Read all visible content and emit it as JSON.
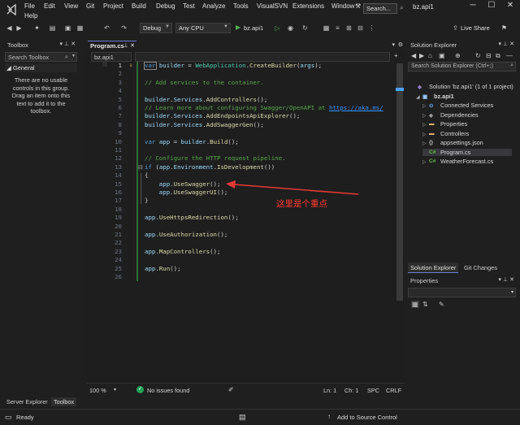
{
  "titlebar": {
    "menu": [
      "File",
      "Edit",
      "View",
      "Git",
      "Project",
      "Build",
      "Debug",
      "Test",
      "Analyze",
      "Tools",
      "VisualSVN",
      "Extensions",
      "Window",
      "Help"
    ],
    "search_label": "Search...",
    "window_title": "bz.api1",
    "minimize": "─",
    "maximize": "☐",
    "close": "✕"
  },
  "toolbar": {
    "config": "Debug",
    "platform": "Any CPU",
    "run_target": "bz.api1",
    "live_share": "Live Share"
  },
  "toolbox": {
    "title": "Toolbox",
    "search_placeholder": "Search Toolbox",
    "group": "General",
    "empty_message": "There are no usable controls in this group. Drag an item onto this text to add it to the toolbox.",
    "tabs": [
      "Server Explorer",
      "Toolbox"
    ]
  },
  "editor": {
    "tab_title": "Program.cs",
    "nav_project": "bz.api1",
    "zoom": "100 %",
    "issues": "No issues found",
    "line_info": "Ln: 1",
    "col_info": "Ch: 1",
    "encoding": "SPC",
    "line_ending": "CRLF",
    "annotation": "这里是个重点",
    "lines": [
      {
        "n": "1",
        "segments": [
          {
            "t": "var",
            "c": "kw"
          },
          {
            "t": " ",
            "c": "pl"
          },
          {
            "t": "builder",
            "c": "id"
          },
          {
            "t": " = ",
            "c": "pl"
          },
          {
            "t": "WebApplication",
            "c": "ty"
          },
          {
            "t": ".",
            "c": "pl"
          },
          {
            "t": "CreateBuilder",
            "c": "mt"
          },
          {
            "t": "(",
            "c": "pl"
          },
          {
            "t": "args",
            "c": "id"
          },
          {
            "t": ");",
            "c": "pl"
          }
        ]
      },
      {
        "n": "2",
        "segments": []
      },
      {
        "n": "3",
        "segments": [
          {
            "t": "// Add services to the container.",
            "c": "cm"
          }
        ]
      },
      {
        "n": "4",
        "segments": []
      },
      {
        "n": "5",
        "segments": [
          {
            "t": "builder",
            "c": "id"
          },
          {
            "t": ".",
            "c": "pl"
          },
          {
            "t": "Services",
            "c": "id"
          },
          {
            "t": ".",
            "c": "pl"
          },
          {
            "t": "AddControllers",
            "c": "mt"
          },
          {
            "t": "();",
            "c": "pl"
          }
        ]
      },
      {
        "n": "6",
        "segments": [
          {
            "t": "// Learn more about configuring Swagger/OpenAPI at ",
            "c": "cm"
          },
          {
            "t": "https://aka.ms/",
            "c": "ln-link"
          }
        ]
      },
      {
        "n": "7",
        "segments": [
          {
            "t": "builder",
            "c": "id"
          },
          {
            "t": ".",
            "c": "pl"
          },
          {
            "t": "Services",
            "c": "id"
          },
          {
            "t": ".",
            "c": "pl"
          },
          {
            "t": "AddEndpointsApiExplorer",
            "c": "mt"
          },
          {
            "t": "();",
            "c": "pl"
          }
        ]
      },
      {
        "n": "8",
        "segments": [
          {
            "t": "builder",
            "c": "id"
          },
          {
            "t": ".",
            "c": "pl"
          },
          {
            "t": "Services",
            "c": "id"
          },
          {
            "t": ".",
            "c": "pl"
          },
          {
            "t": "AddSwaggerGen",
            "c": "mt"
          },
          {
            "t": "();",
            "c": "pl"
          }
        ]
      },
      {
        "n": "9",
        "segments": []
      },
      {
        "n": "10",
        "segments": [
          {
            "t": "var",
            "c": "kw"
          },
          {
            "t": " ",
            "c": "pl"
          },
          {
            "t": "app",
            "c": "id"
          },
          {
            "t": " = ",
            "c": "pl"
          },
          {
            "t": "builder",
            "c": "id"
          },
          {
            "t": ".",
            "c": "pl"
          },
          {
            "t": "Build",
            "c": "mt"
          },
          {
            "t": "();",
            "c": "pl"
          }
        ]
      },
      {
        "n": "11",
        "segments": []
      },
      {
        "n": "12",
        "segments": [
          {
            "t": "// Configure the HTTP request pipeline.",
            "c": "cm"
          }
        ]
      },
      {
        "n": "13",
        "segments": [
          {
            "t": "if",
            "c": "kw"
          },
          {
            "t": " (",
            "c": "pl"
          },
          {
            "t": "app",
            "c": "id"
          },
          {
            "t": ".",
            "c": "pl"
          },
          {
            "t": "Environment",
            "c": "id"
          },
          {
            "t": ".",
            "c": "pl"
          },
          {
            "t": "IsDevelopment",
            "c": "mt"
          },
          {
            "t": "())",
            "c": "pl"
          }
        ]
      },
      {
        "n": "14",
        "segments": [
          {
            "t": "{",
            "c": "pl"
          }
        ]
      },
      {
        "n": "15",
        "segments": [
          {
            "t": "    app",
            "c": "id"
          },
          {
            "t": ".",
            "c": "pl"
          },
          {
            "t": "UseSwagger",
            "c": "mt"
          },
          {
            "t": "();",
            "c": "pl"
          }
        ]
      },
      {
        "n": "16",
        "segments": [
          {
            "t": "    app",
            "c": "id"
          },
          {
            "t": ".",
            "c": "pl"
          },
          {
            "t": "UseSwaggerUI",
            "c": "mt"
          },
          {
            "t": "();",
            "c": "pl"
          }
        ]
      },
      {
        "n": "17",
        "segments": [
          {
            "t": "}",
            "c": "pl"
          }
        ]
      },
      {
        "n": "18",
        "segments": []
      },
      {
        "n": "19",
        "segments": [
          {
            "t": "app",
            "c": "id"
          },
          {
            "t": ".",
            "c": "pl"
          },
          {
            "t": "UseHttpsRedirection",
            "c": "mt"
          },
          {
            "t": "();",
            "c": "pl"
          }
        ]
      },
      {
        "n": "20",
        "segments": []
      },
      {
        "n": "21",
        "segments": [
          {
            "t": "app",
            "c": "id"
          },
          {
            "t": ".",
            "c": "pl"
          },
          {
            "t": "UseAuthorization",
            "c": "mt"
          },
          {
            "t": "();",
            "c": "pl"
          }
        ]
      },
      {
        "n": "22",
        "segments": []
      },
      {
        "n": "23",
        "segments": [
          {
            "t": "app",
            "c": "id"
          },
          {
            "t": ".",
            "c": "pl"
          },
          {
            "t": "MapControllers",
            "c": "mt"
          },
          {
            "t": "();",
            "c": "pl"
          }
        ]
      },
      {
        "n": "24",
        "segments": []
      },
      {
        "n": "25",
        "segments": [
          {
            "t": "app",
            "c": "id"
          },
          {
            "t": ".",
            "c": "pl"
          },
          {
            "t": "Run",
            "c": "mt"
          },
          {
            "t": "();",
            "c": "pl"
          }
        ]
      },
      {
        "n": "26",
        "segments": []
      }
    ]
  },
  "solution_explorer": {
    "title": "Solution Explorer",
    "search_placeholder": "Search Solution Explorer (Ctrl+;)",
    "items": [
      {
        "label": "Solution 'bz.api1' (1 of 1 project)",
        "icon": "solution-icon"
      },
      {
        "label": "bz.api1",
        "icon": "project-icon"
      },
      {
        "label": "Connected Services",
        "icon": "connected-services-icon"
      },
      {
        "label": "Dependencies",
        "icon": "dependencies-icon"
      },
      {
        "label": "Properties",
        "icon": "folder-icon"
      },
      {
        "label": "Controllers",
        "icon": "folder-icon"
      },
      {
        "label": "appsettings.json",
        "icon": "json-file-icon"
      },
      {
        "label": "Program.cs",
        "icon": "csharp-file-icon"
      },
      {
        "label": "WeatherForecast.cs",
        "icon": "csharp-file-icon"
      }
    ],
    "tabs": [
      "Solution Explorer",
      "Git Changes"
    ]
  },
  "properties": {
    "title": "Properties"
  },
  "statusbar": {
    "status": "Ready",
    "source_control": "Add to Source Control"
  }
}
